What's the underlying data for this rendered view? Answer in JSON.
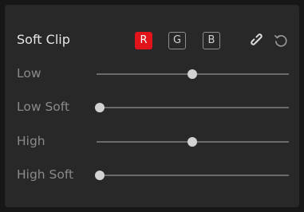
{
  "panel": {
    "title": "Soft Clip",
    "channels": [
      {
        "label": "R",
        "active": true
      },
      {
        "label": "G",
        "active": false
      },
      {
        "label": "B",
        "active": false
      }
    ],
    "icons": {
      "link": "link-icon",
      "reset": "reset-icon"
    }
  },
  "params": [
    {
      "label": "Low",
      "value_fraction": 0.5
    },
    {
      "label": "Low Soft",
      "value_fraction": 0.0
    },
    {
      "label": "High",
      "value_fraction": 0.5
    },
    {
      "label": "High Soft",
      "value_fraction": 0.0
    }
  ],
  "colors": {
    "accent_red": "#e0141a",
    "panel_bg": "#282828",
    "outer_bg": "#171717"
  }
}
